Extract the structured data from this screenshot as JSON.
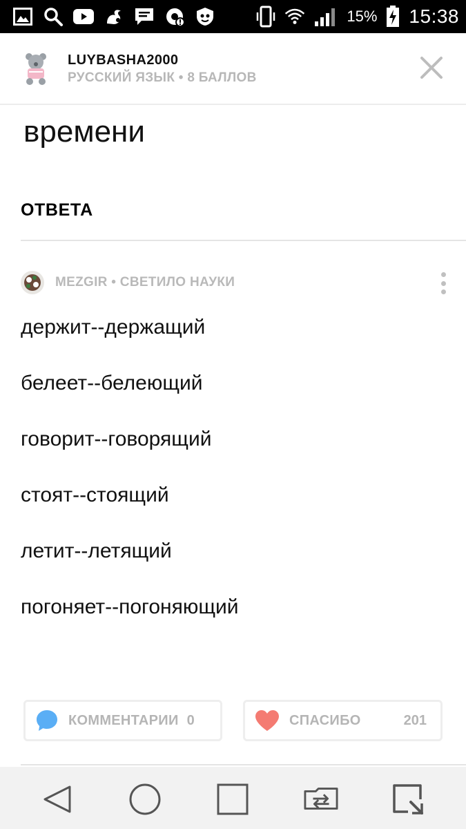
{
  "status_bar": {
    "battery_percent": "15%",
    "time": "15:38",
    "left_icons": [
      "gallery-icon",
      "search-icon",
      "youtube-icon",
      "uc-browser-icon",
      "messages-icon",
      "alert-app-icon",
      "shield-app-icon"
    ],
    "right_icons": [
      "vibrate-icon",
      "wifi-icon",
      "signal-icon",
      "battery-charging-icon"
    ]
  },
  "header": {
    "username": "LUYBASHA2000",
    "meta": "РУССКИЙ ЯЗЫК • 8 БАЛЛОВ",
    "close_icon": "close-icon"
  },
  "question": {
    "visible_text": "времени"
  },
  "answers_section": {
    "heading": "ОТВЕТА"
  },
  "answer": {
    "author_meta": "MEZGIR • СВЕТИЛО НАУКИ",
    "lines": [
      "держит--держащий",
      "белеет--белеющий",
      "говорит--говорящий",
      "стоят--стоящий",
      "летит--летящий",
      "погоняет--погоняющий"
    ]
  },
  "actions": {
    "comments_label": "КОММЕНТАРИИ",
    "comments_count": "0",
    "thanks_label": "СПАСИБО",
    "thanks_count": "201"
  },
  "colors": {
    "comment_icon": "#5aaef5",
    "heart_icon": "#f47b72",
    "muted_text": "#b5b5b5",
    "status_bar_bg": "#000000",
    "nav_bar_bg": "#f2f2f2"
  },
  "nav_bar": {
    "icons": [
      "back-icon",
      "home-icon",
      "recents-icon",
      "dual-window-icon",
      "capture-plus-icon"
    ]
  }
}
